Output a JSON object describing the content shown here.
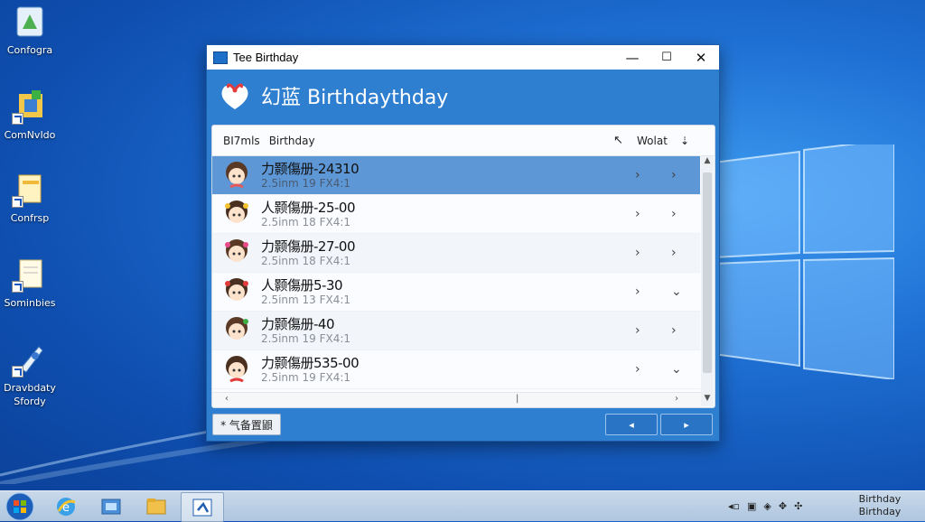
{
  "desktop": {
    "icons": [
      {
        "label": "Confogra"
      },
      {
        "label": "ComNvIdo"
      },
      {
        "label": "Confrsp"
      },
      {
        "label": "Sominbies"
      },
      {
        "label": "Dravbdaty Sfordy"
      }
    ]
  },
  "window": {
    "title": "Tee Birthday",
    "header_title": "幻蓝 Birthdaythday",
    "controls": {
      "minimize": "—",
      "maximize": "☐",
      "close": "✕"
    },
    "columns": {
      "col1": "BI7mls",
      "col2": "Birthday",
      "sort_icon": "↖",
      "col3": "Wolat",
      "sort_dir": "⇣"
    },
    "rows": [
      {
        "name": "力颢傷册-24310",
        "sub": "2.5inm 19 FX4:1",
        "chev1": "›",
        "chev2": "›",
        "selected": true
      },
      {
        "name": "人颢傷册-25-00",
        "sub": "2.5inm 18 FX4:1",
        "chev1": "›",
        "chev2": "›",
        "selected": false
      },
      {
        "name": "力颢傷册-27-00",
        "sub": "2.5inm 18 FX4:1",
        "chev1": "›",
        "chev2": "›",
        "selected": false
      },
      {
        "name": "人颢傷册5-30",
        "sub": "2.5inm 13 FX4:1",
        "chev1": "›",
        "chev2": "⌄",
        "selected": false
      },
      {
        "name": "力颢傷册-40",
        "sub": "2.5inm 19 FX4:1",
        "chev1": "›",
        "chev2": "›",
        "selected": false
      },
      {
        "name": "力颢傷册535-00",
        "sub": "2.5inm 19 FX4:1",
        "chev1": "›",
        "chev2": "⌄",
        "selected": false
      }
    ],
    "hscroll": {
      "left": "‹",
      "mid": "|",
      "right": "›"
    },
    "footer": {
      "left_button": "* 气备置鼰",
      "prev": "◂",
      "next": "▸"
    }
  },
  "taskbar": {
    "clock_line1": "Birthday",
    "clock_line2": "Birthday"
  },
  "colors": {
    "window_blue": "#2f7fd0",
    "selected_row": "#5e97d6",
    "desktop": "#1e6fd3"
  }
}
